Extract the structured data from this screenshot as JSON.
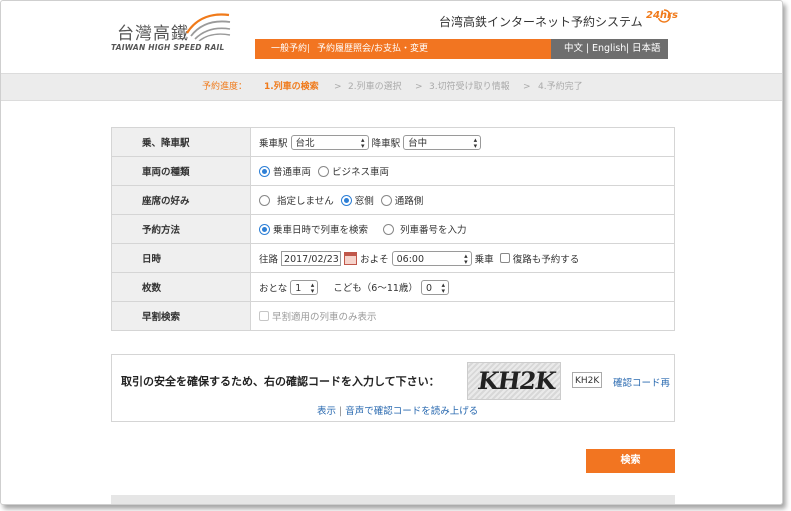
{
  "header": {
    "logo_cn": "台灣高鐵",
    "logo_en": "TAIWAN HIGH SPEED RAIL",
    "system_title": "台湾高鉄インターネット予約システム",
    "badge_24": "24hrs",
    "nav_left": [
      "一般予約",
      "予約履歴照会/お支払・変更"
    ],
    "nav_lang": [
      "中文",
      "English",
      "日本語"
    ],
    "sep": "|"
  },
  "progress": {
    "label": "予約進度：",
    "steps": [
      "1.列車の検索",
      "2.列車の選択",
      "3.切符受け取り情報",
      "4.予約完了"
    ],
    "arrow": ">"
  },
  "form": {
    "station": {
      "label": "乗、降車駅",
      "from_label": "乗車駅",
      "from_value": "台北",
      "to_label": "降車駅",
      "to_value": "台中"
    },
    "car_type": {
      "label": "車両の種類",
      "options": [
        "普通車両",
        "ビジネス車両"
      ],
      "selected": "普通車両"
    },
    "seat": {
      "label": "座席の好み",
      "options": [
        "指定しません",
        "窓側",
        "通路側"
      ],
      "selected": "窓側"
    },
    "method": {
      "label": "予約方法",
      "options": [
        "乗車日時で列車を検索",
        "列車番号を入力"
      ],
      "selected": "乗車日時で列車を検索"
    },
    "datetime": {
      "label": "日時",
      "outbound_label": "往路",
      "date": "2017/02/23",
      "about": "およそ",
      "time": "06:00",
      "board": "乗車",
      "return_label": "復路も予約する"
    },
    "tickets": {
      "label": "枚数",
      "adult_label": "おとな",
      "adult_value": "1",
      "child_label": "こども（6〜11歳）",
      "child_value": "0"
    },
    "early": {
      "label": "早割検索",
      "option": "早割適用の列車のみ表示"
    }
  },
  "captcha": {
    "prompt": "取引の安全を確保するため、右の確認コードを入力して下さい：",
    "image_text": "KH2K",
    "input_value": "KH2K",
    "refresh": "確認コード再",
    "show": "表示",
    "audio": "音声で確認コードを読み上げる",
    "sep": "|"
  },
  "actions": {
    "search": "検索"
  },
  "colors": {
    "accent": "#f27521",
    "lang_bar": "#6e6e6e",
    "link": "#2a6ab0"
  }
}
